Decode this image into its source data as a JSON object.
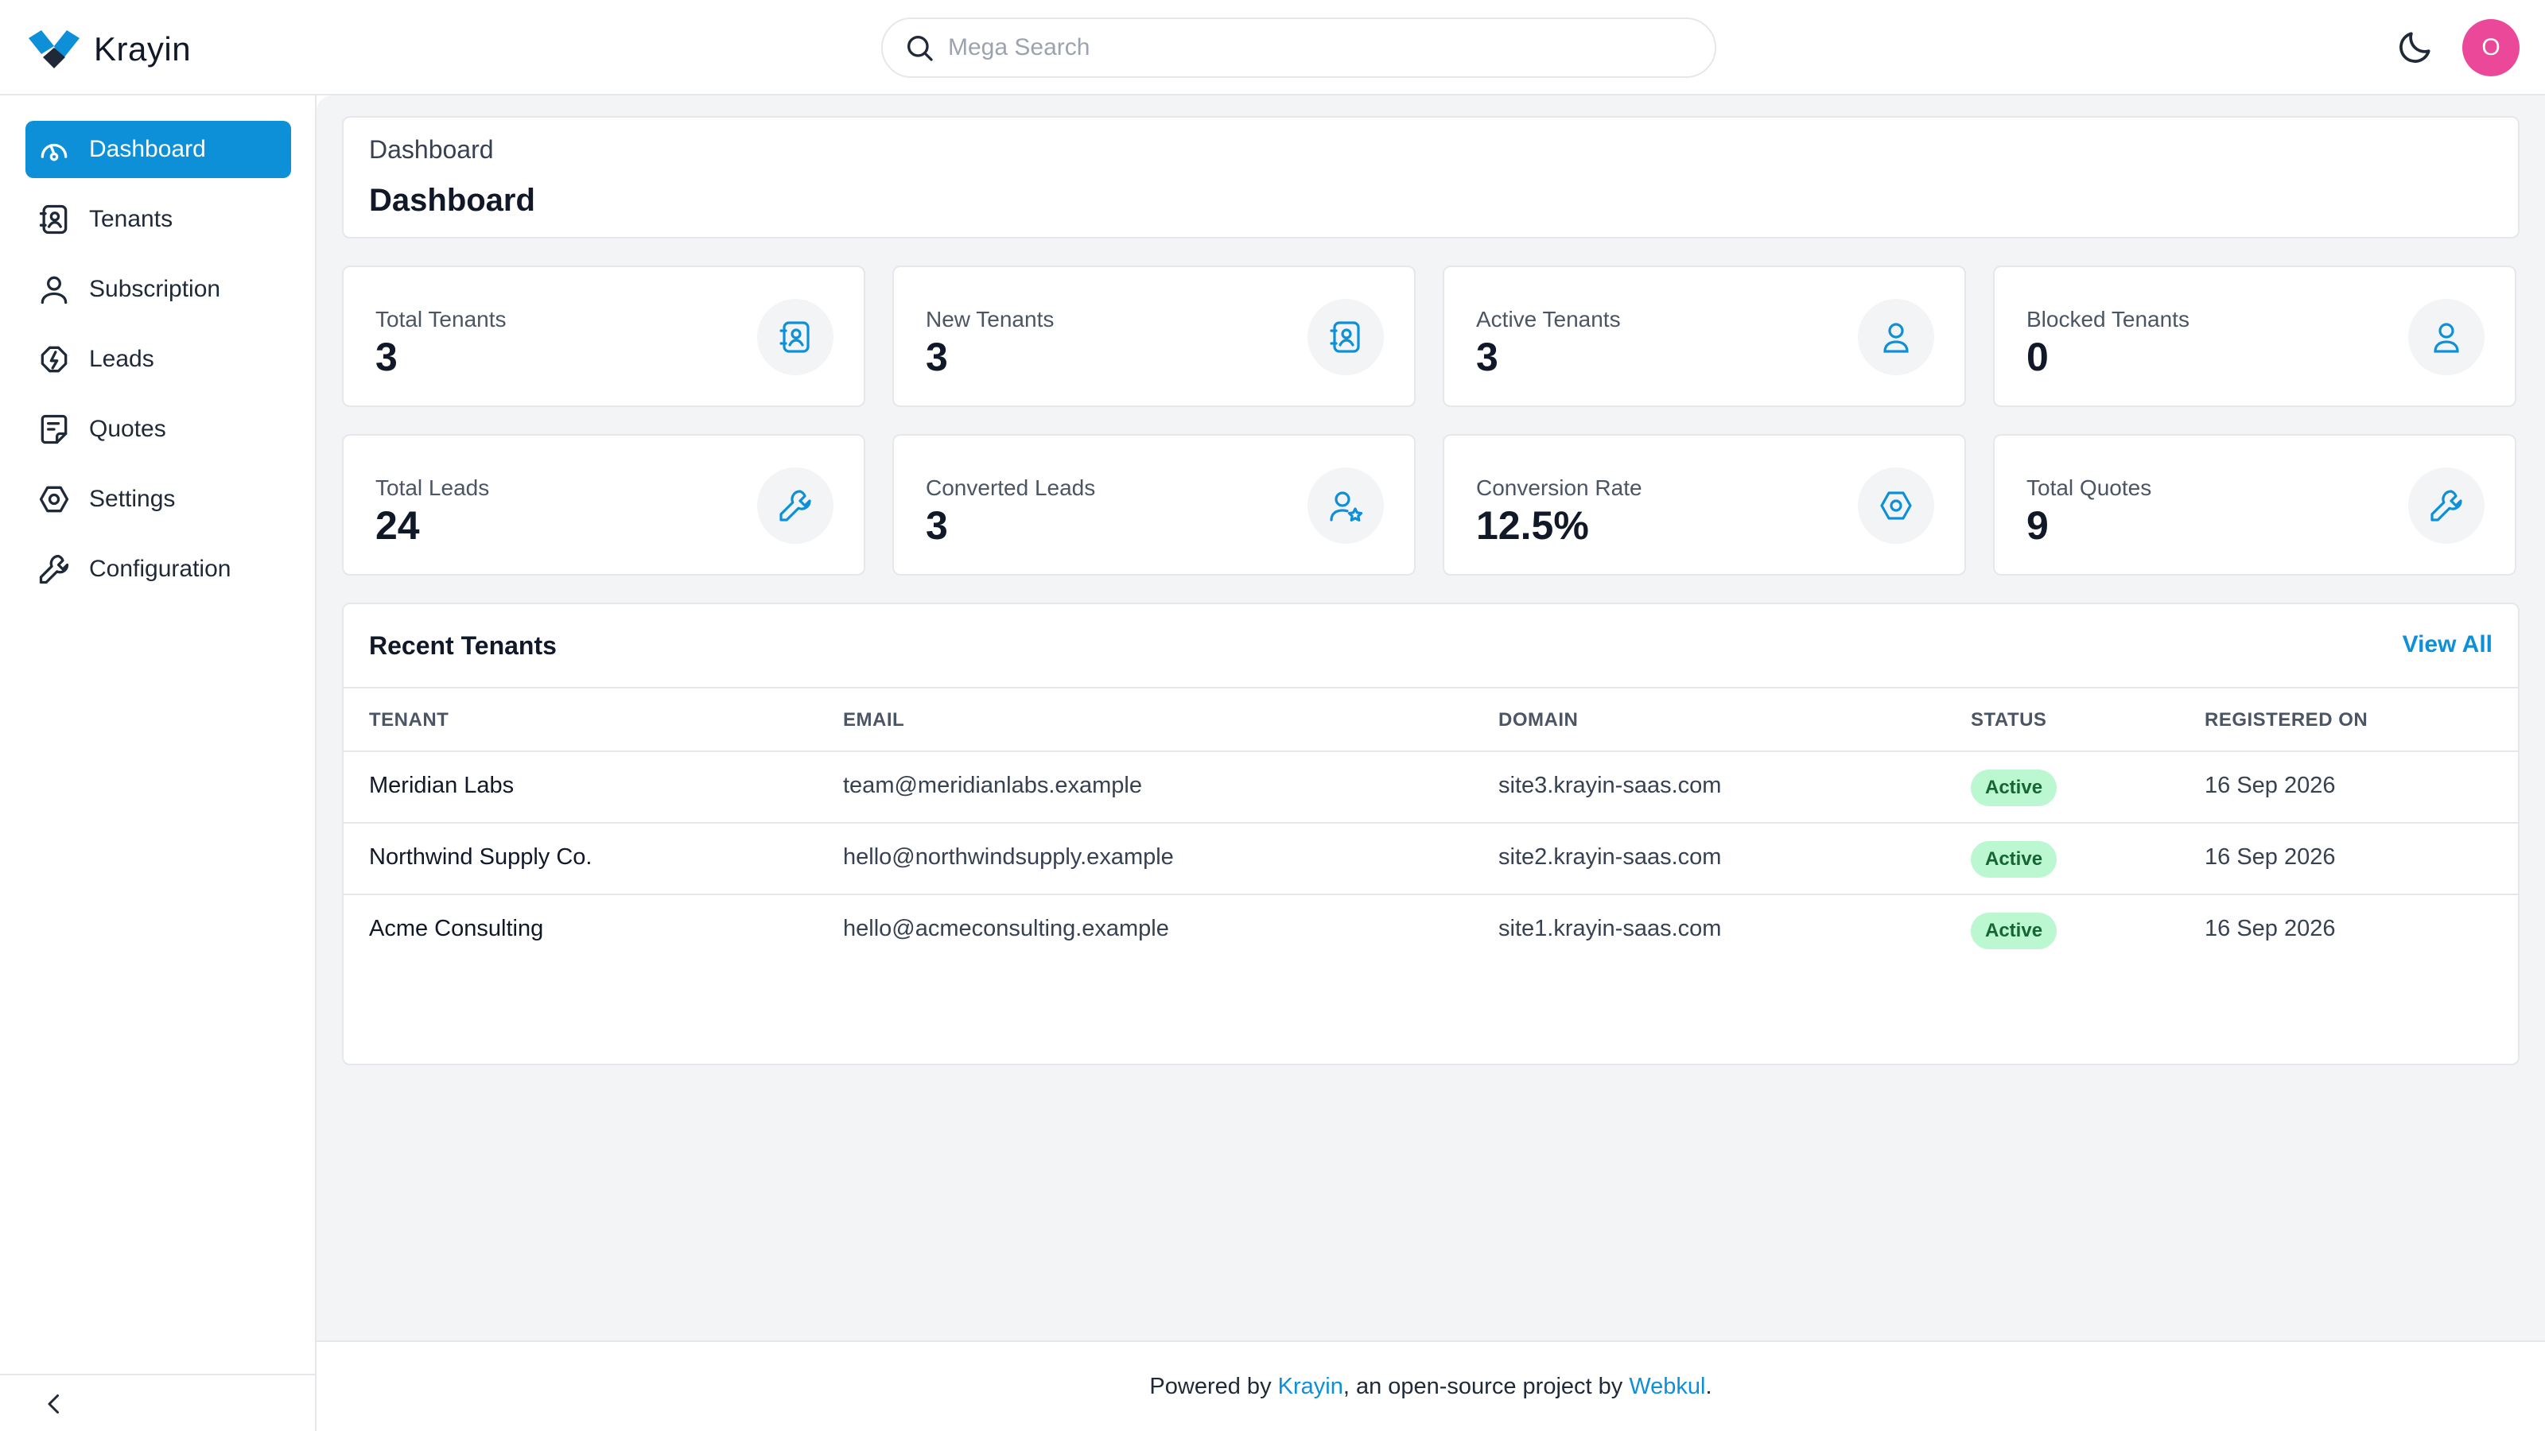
{
  "app": {
    "name": "Krayin"
  },
  "search": {
    "placeholder": "Mega Search"
  },
  "header": {
    "avatar_initial": "O"
  },
  "sidebar": {
    "items": [
      {
        "label": "Dashboard",
        "icon": "dashboard-icon",
        "active": true
      },
      {
        "label": "Tenants",
        "icon": "tenants-icon"
      },
      {
        "label": "Subscription",
        "icon": "user-icon"
      },
      {
        "label": "Leads",
        "icon": "leads-icon"
      },
      {
        "label": "Quotes",
        "icon": "quotes-icon"
      },
      {
        "label": "Settings",
        "icon": "settings-icon"
      },
      {
        "label": "Configuration",
        "icon": "wrench-icon"
      }
    ]
  },
  "page": {
    "breadcrumb": "Dashboard",
    "title": "Dashboard"
  },
  "stats": [
    {
      "label": "Total Tenants",
      "value": "3",
      "icon": "tenants-icon"
    },
    {
      "label": "New Tenants",
      "value": "3",
      "icon": "tenants-icon"
    },
    {
      "label": "Active Tenants",
      "value": "3",
      "icon": "user-icon"
    },
    {
      "label": "Blocked Tenants",
      "value": "0",
      "icon": "user-icon"
    },
    {
      "label": "Total Leads",
      "value": "24",
      "icon": "wrench-icon"
    },
    {
      "label": "Converted Leads",
      "value": "3",
      "icon": "user-star-icon"
    },
    {
      "label": "Conversion Rate",
      "value": "12.5%",
      "icon": "settings-icon"
    },
    {
      "label": "Total Quotes",
      "value": "9",
      "icon": "wrench-icon"
    }
  ],
  "recent": {
    "title": "Recent Tenants",
    "view_all": "View All",
    "columns": [
      "TENANT",
      "EMAIL",
      "DOMAIN",
      "STATUS",
      "REGISTERED ON"
    ],
    "rows": [
      {
        "tenant": "Meridian Labs",
        "email": "team@meridianlabs.example",
        "domain": "site3.krayin-saas.com",
        "status": "Active",
        "registered": "16 Sep 2026"
      },
      {
        "tenant": "Northwind Supply Co.",
        "email": "hello@northwindsupply.example",
        "domain": "site2.krayin-saas.com",
        "status": "Active",
        "registered": "16 Sep 2026"
      },
      {
        "tenant": "Acme Consulting",
        "email": "hello@acmeconsulting.example",
        "domain": "site1.krayin-saas.com",
        "status": "Active",
        "registered": "16 Sep 2026"
      }
    ]
  },
  "footer": {
    "prefix": "Powered by ",
    "link1": "Krayin",
    "middle": ", an open-source project by ",
    "link2": "Webkul",
    "suffix": "."
  },
  "colors": {
    "accent": "#0e90d9",
    "avatar": "#ec4899",
    "badge_bg": "#bbf7d0",
    "badge_text": "#166534"
  }
}
